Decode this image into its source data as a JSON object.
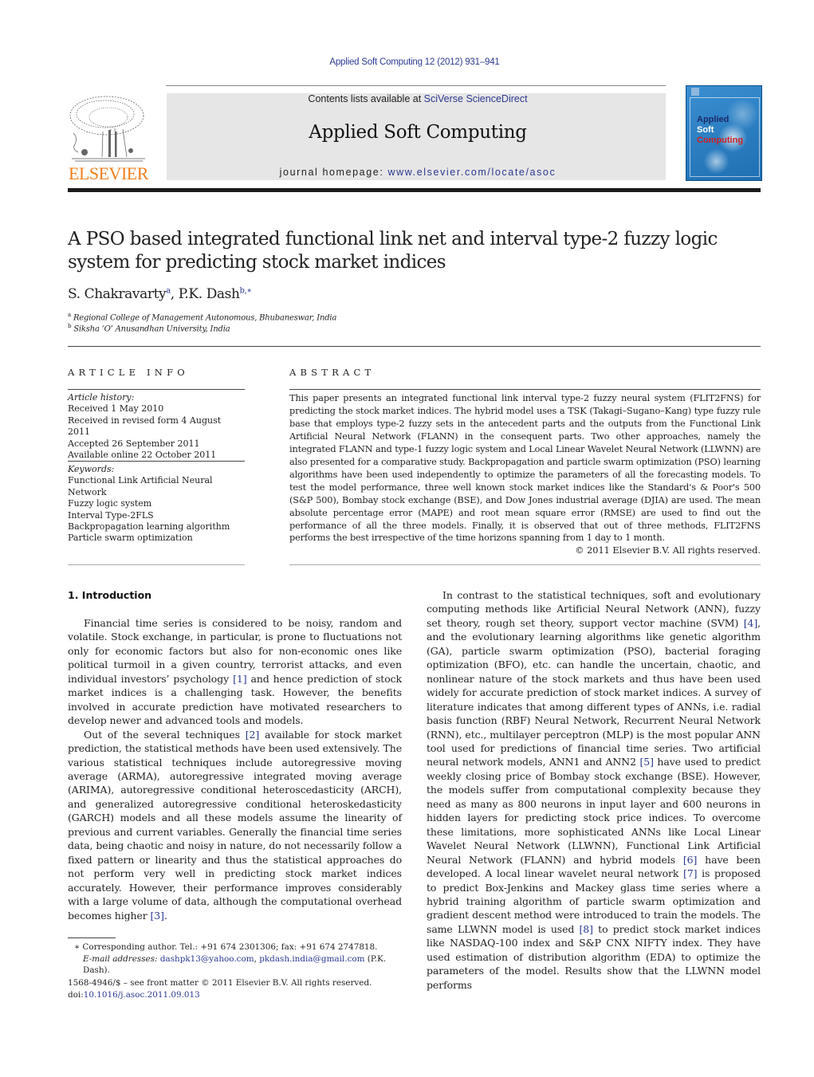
{
  "header": {
    "citation": "Applied Soft Computing 12 (2012) 931–941",
    "contents_prefix": "Contents lists available at ",
    "contents_link": "SciVerse ScienceDirect",
    "journal_title": "Applied Soft Computing",
    "homepage_prefix": "journal homepage: ",
    "homepage_link": "www.elsevier.com/locate/asoc",
    "publisher_logo_text": "ELSEVIER",
    "cover_words": [
      "Applied",
      "Soft",
      "Computing"
    ],
    "colors": {
      "link": "#2b3990",
      "elsevier_orange": "#f07f1d",
      "cover_blue": "#2d7fc1",
      "cover_red": "#d02020"
    }
  },
  "article": {
    "title": "A PSO based integrated functional link net and interval type-2 fuzzy logic system for predicting stock market indices",
    "authors": [
      {
        "name": "S. Chakravarty",
        "marks": "a"
      },
      {
        "name": "P.K. Dash",
        "marks": "b,∗"
      }
    ],
    "affiliations": [
      {
        "mark": "a",
        "text": "Regional College of Management Autonomous, Bhubaneswar, India"
      },
      {
        "mark": "b",
        "text": "Siksha ‘O’ Anusandhan University, India"
      }
    ]
  },
  "article_info": {
    "heading": "ARTICLE INFO",
    "history_label": "Article history:",
    "history": [
      "Received 1 May 2010",
      "Received in revised form 4 August 2011",
      "Accepted 26 September 2011",
      "Available online 22 October 2011"
    ],
    "keywords_label": "Keywords:",
    "keywords": [
      "Functional Link Artificial Neural Network",
      "Fuzzy logic system",
      "Interval Type-2FLS",
      "Backpropagation learning algorithm",
      "Particle swarm optimization"
    ]
  },
  "abstract": {
    "heading": "ABSTRACT",
    "text": "This paper presents an integrated functional link interval type-2 fuzzy neural system (FLIT2FNS) for predicting the stock market indices. The hybrid model uses a TSK (Takagi–Sugano–Kang) type fuzzy rule base that employs type-2 fuzzy sets in the antecedent parts and the outputs from the Functional Link Artificial Neural Network (FLANN) in the consequent parts. Two other approaches, namely the integrated FLANN and type-1 fuzzy logic system and Local Linear Wavelet Neural Network (LLWNN) are also presented for a comparative study. Backpropagation and particle swarm optimization (PSO) learning algorithms have been used independently to optimize the parameters of all the forecasting models. To test the model performance, three well known stock market indices like the Standard's & Poor's 500 (S&P 500), Bombay stock exchange (BSE), and Dow Jones industrial average (DJIA) are used. The mean absolute percentage error (MAPE) and root mean square error (RMSE) are used to find out the performance of all the three models. Finally, it is observed that out of three methods, FLIT2FNS performs the best irrespective of the time horizons spanning from 1 day to 1 month.",
    "copyright": "© 2011 Elsevier B.V. All rights reserved."
  },
  "body": {
    "section_heading": "1.  Introduction",
    "left_paragraphs": [
      [
        {
          "t": "Financial time series is considered to be noisy, random and volatile. Stock exchange, in particular, is prone to fluctuations not only for economic factors but also for non-economic ones like political turmoil in a given country, terrorist attacks, and even individual investors’ psychology "
        },
        {
          "ref": "[1]"
        },
        {
          "t": " and hence prediction of stock market indices is a challenging task. However, the benefits involved in accurate prediction have motivated researchers to develop newer and advanced tools and models."
        }
      ],
      [
        {
          "t": "Out of the several techniques "
        },
        {
          "ref": "[2]"
        },
        {
          "t": " available for stock market prediction, the statistical methods have been used extensively. The various statistical techniques include autoregressive moving average (ARMA), autoregressive integrated moving average (ARIMA), autoregressive conditional heteroscedasticity (ARCH), and generalized autoregressive conditional heteroskedasticity (GARCH) models and all these models assume the linearity of previous and current variables. Generally the financial time series data, being chaotic and noisy in nature, do not necessarily follow a fixed pattern or linearity and thus the statistical approaches do not perform very well in predicting stock market indices accurately. However, their performance improves considerably with a large volume of data, although the computational overhead becomes higher "
        },
        {
          "ref": "[3]"
        },
        {
          "t": "."
        }
      ]
    ],
    "right_paragraphs": [
      [
        {
          "t": "In contrast to the statistical techniques, soft and evolutionary computing methods like Artificial Neural Network (ANN), fuzzy set theory, rough set theory, support vector machine (SVM) "
        },
        {
          "ref": "[4]"
        },
        {
          "t": ", and the evolutionary learning algorithms like genetic algorithm (GA), particle swarm optimization (PSO), bacterial foraging optimization (BFO), etc. can handle the uncertain, chaotic, and nonlinear nature of the stock markets and thus have been used widely for accurate prediction of stock market indices. A survey of literature indicates that among different types of ANNs, i.e. radial basis function (RBF) Neural Network, Recurrent Neural Network (RNN), etc., multilayer perceptron (MLP) is the most popular ANN tool used for predictions of financial time series. Two artificial neural network models, ANN1 and ANN2 "
        },
        {
          "ref": "[5]"
        },
        {
          "t": " have used to predict weekly closing price of Bombay stock exchange (BSE). However, the models suffer from computational complexity because they need as many as 800 neurons in input layer and 600 neurons in hidden layers for predicting stock price indices. To overcome these limitations, more sophisticated ANNs like Local Linear Wavelet Neural Network (LLWNN), Functional Link Artificial Neural Network (FLANN) and hybrid models "
        },
        {
          "ref": "[6]"
        },
        {
          "t": " have been developed. A local linear wavelet neural network "
        },
        {
          "ref": "[7]"
        },
        {
          "t": " is proposed to predict Box-Jenkins and Mackey glass time series where a hybrid training algorithm of particle swarm optimization and gradient descent method were introduced to train the models. The same LLWNN model is used "
        },
        {
          "ref": "[8]"
        },
        {
          "t": " to predict stock market indices like NASDAQ-100 index and S&P CNX NIFTY index. They have used estimation of distribution algorithm (EDA) to optimize the parameters of the model. Results show that the LLWNN model performs"
        }
      ]
    ]
  },
  "footnote": {
    "marker": "∗",
    "corresponding": "Corresponding author. Tel.: +91 674 2301306; fax: +91 674 2747818.",
    "email_label": "E-mail addresses:",
    "emails": [
      "dashpk13@yahoo.com",
      "pkdash.india@gmail.com"
    ],
    "email_suffix": " (P.K. Dash)."
  },
  "front_matter": {
    "issn_line": "1568-4946/$ – see front matter © 2011 Elsevier B.V. All rights reserved.",
    "doi_prefix": "doi:",
    "doi": "10.1016/j.asoc.2011.09.013"
  }
}
